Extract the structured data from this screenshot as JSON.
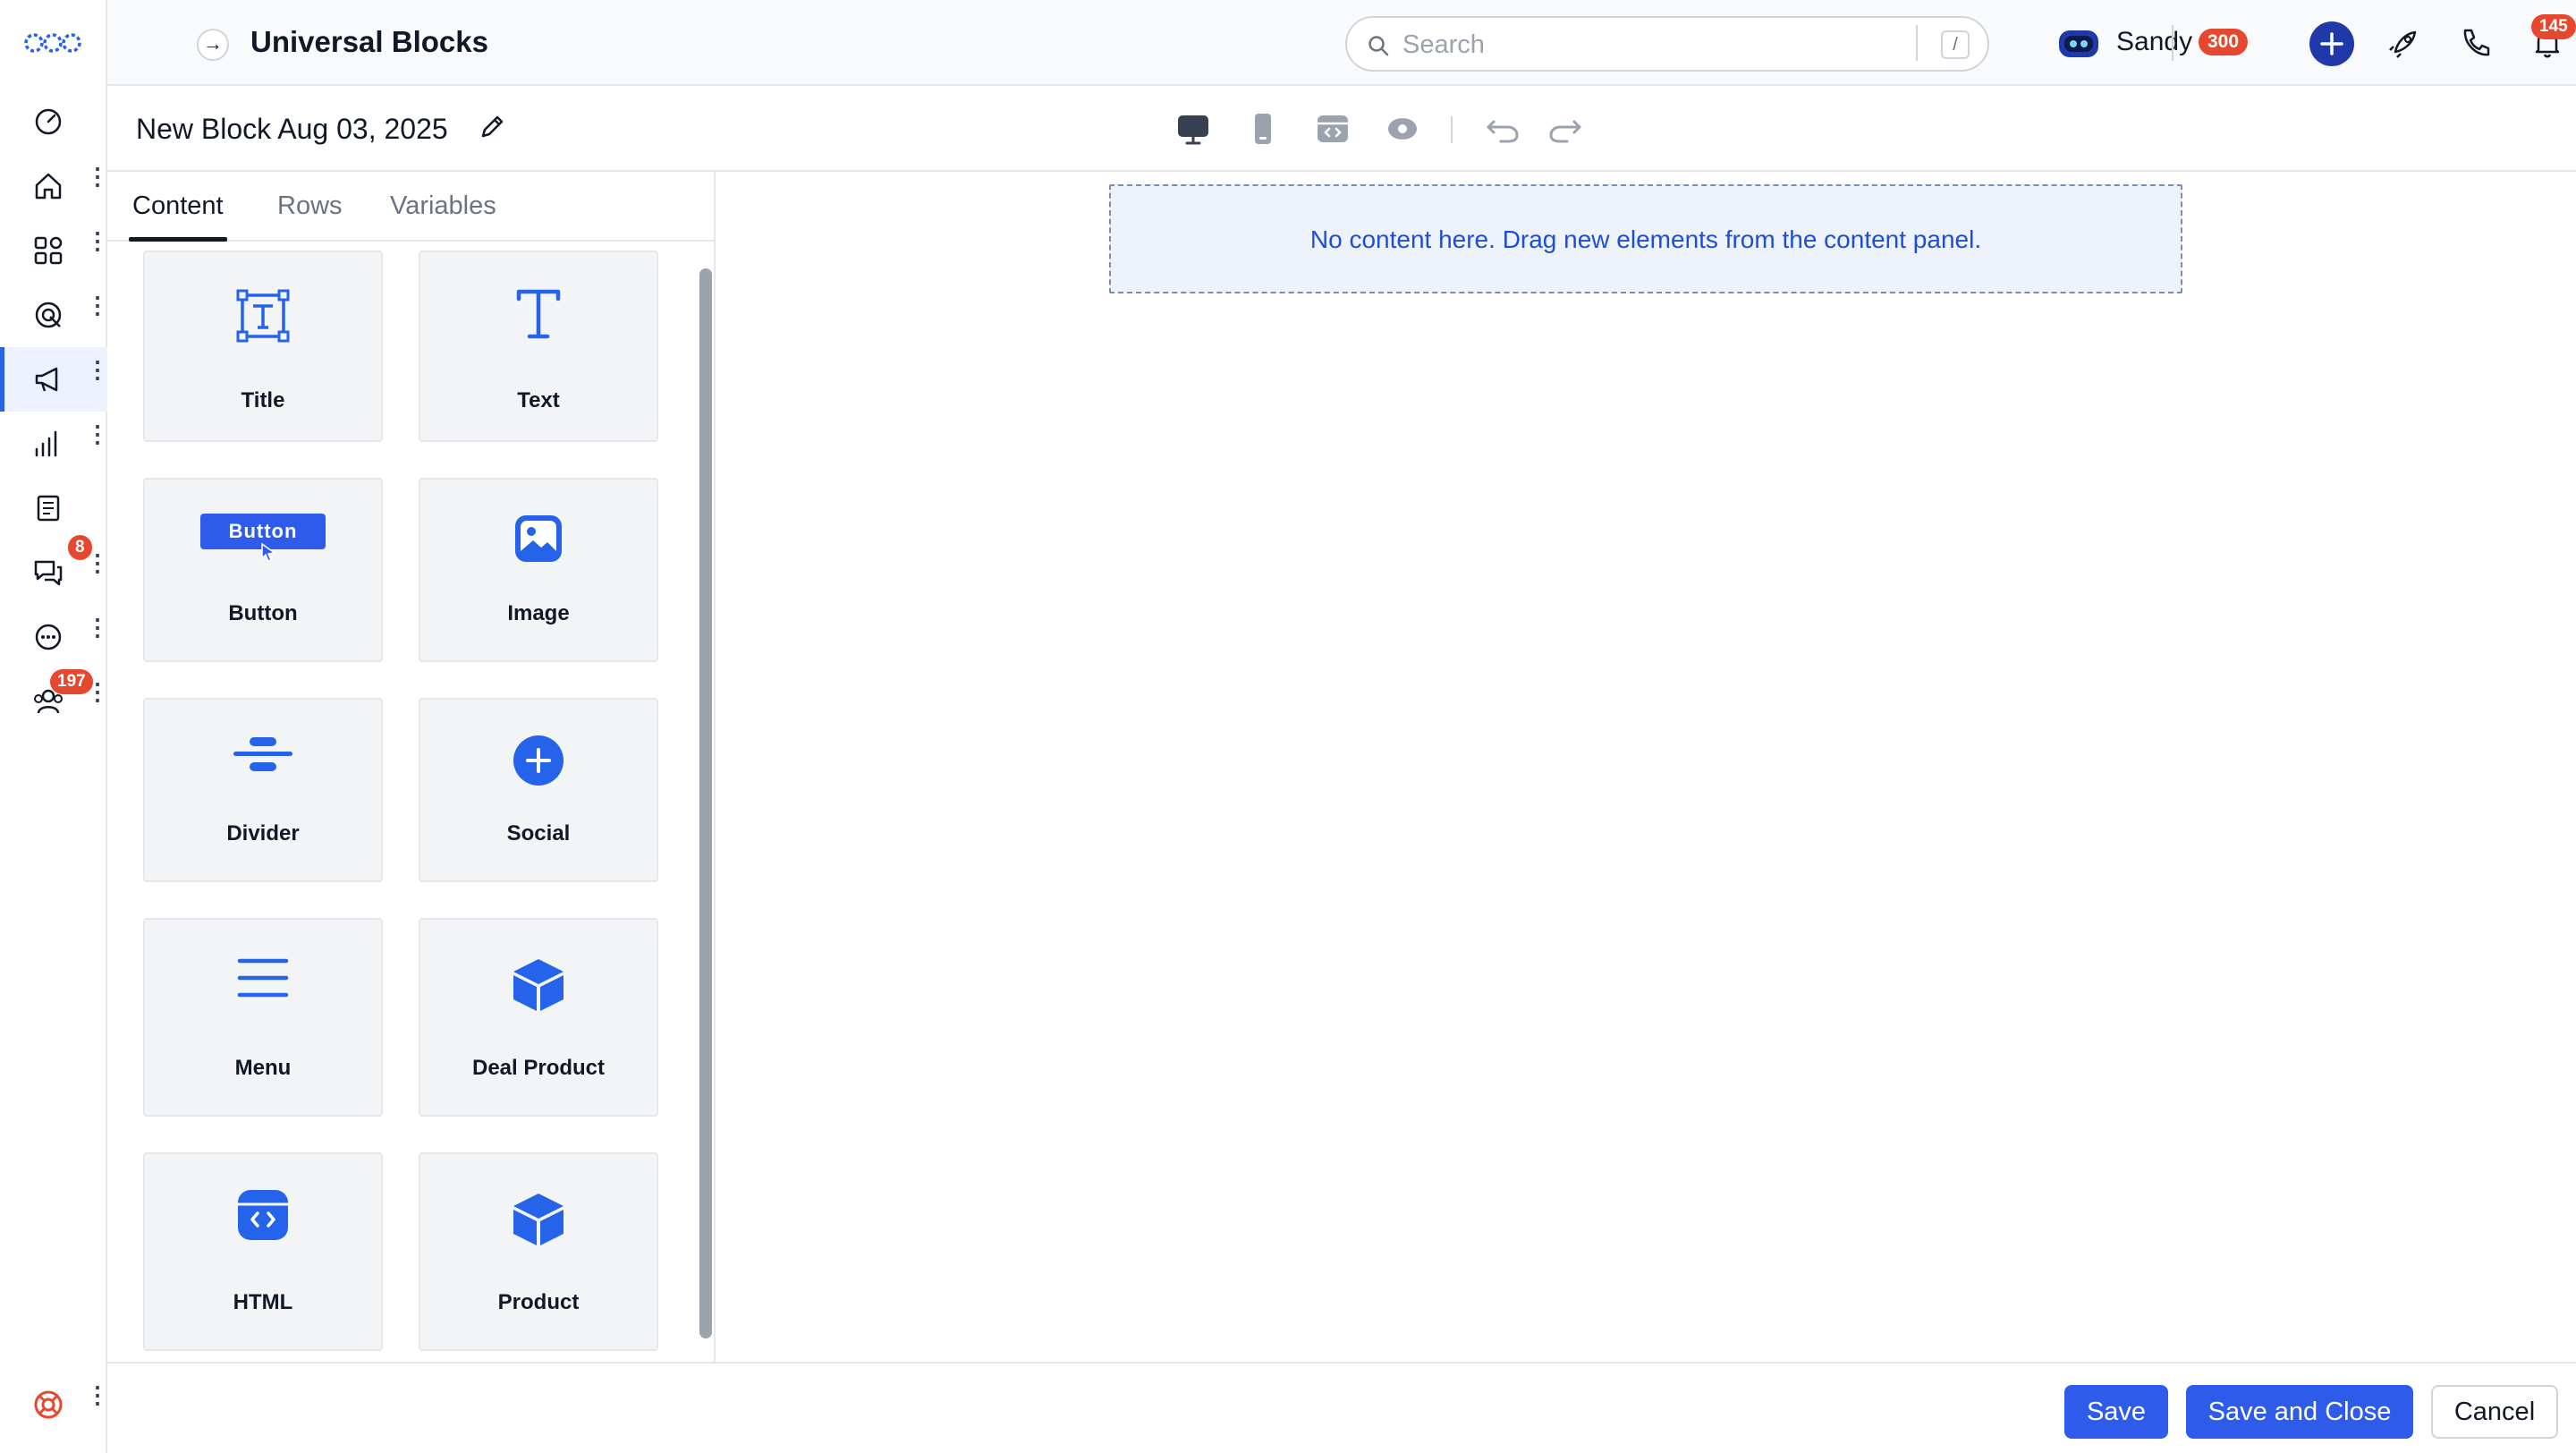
{
  "topbar": {
    "title": "Universal Blocks",
    "search_placeholder": "Search",
    "search_shortcut": "/",
    "user_name": "Sandy",
    "credits": "300",
    "notifications": "145"
  },
  "sidebar": {
    "items": [
      {
        "icon": "speedometer-icon",
        "name": "dashboard"
      },
      {
        "icon": "home-icon",
        "name": "home"
      },
      {
        "icon": "apps-grid-icon",
        "name": "apps"
      },
      {
        "icon": "target-icon",
        "name": "targeting"
      },
      {
        "icon": "megaphone-icon",
        "name": "campaigns"
      },
      {
        "icon": "bar-chart-icon",
        "name": "reports"
      },
      {
        "icon": "document-icon",
        "name": "documents"
      },
      {
        "icon": "chat-icon",
        "name": "conversations",
        "badge": "8"
      },
      {
        "icon": "more-circle-icon",
        "name": "more"
      },
      {
        "icon": "team-icon",
        "name": "team",
        "badge": "197"
      }
    ]
  },
  "editor": {
    "block_name": "New Block Aug 03, 2025"
  },
  "panel": {
    "tabs": [
      {
        "label": "Content"
      },
      {
        "label": "Rows"
      },
      {
        "label": "Variables"
      }
    ],
    "blocks": [
      {
        "label": "Title",
        "icon": "title-frame-icon"
      },
      {
        "label": "Text",
        "icon": "text-t-icon"
      },
      {
        "label": "Button",
        "icon": "button-pill-icon",
        "icon_text": "Button"
      },
      {
        "label": "Image",
        "icon": "image-icon"
      },
      {
        "label": "Divider",
        "icon": "divider-icon"
      },
      {
        "label": "Social",
        "icon": "plus-circle-icon"
      },
      {
        "label": "Menu",
        "icon": "hamburger-menu-icon"
      },
      {
        "label": "Deal Product",
        "icon": "cube-icon"
      },
      {
        "label": "HTML",
        "icon": "html-code-icon"
      },
      {
        "label": "Product",
        "icon": "cube-icon"
      }
    ]
  },
  "canvas": {
    "empty_message": "No content here. Drag new elements from the content panel."
  },
  "footer": {
    "save": "Save",
    "save_close": "Save and Close",
    "cancel": "Cancel"
  },
  "colors": {
    "accent": "#2f5bea",
    "icon_blue": "#2563eb",
    "badge_red": "#e5482e",
    "dropzone_bg": "#eef2fb"
  }
}
